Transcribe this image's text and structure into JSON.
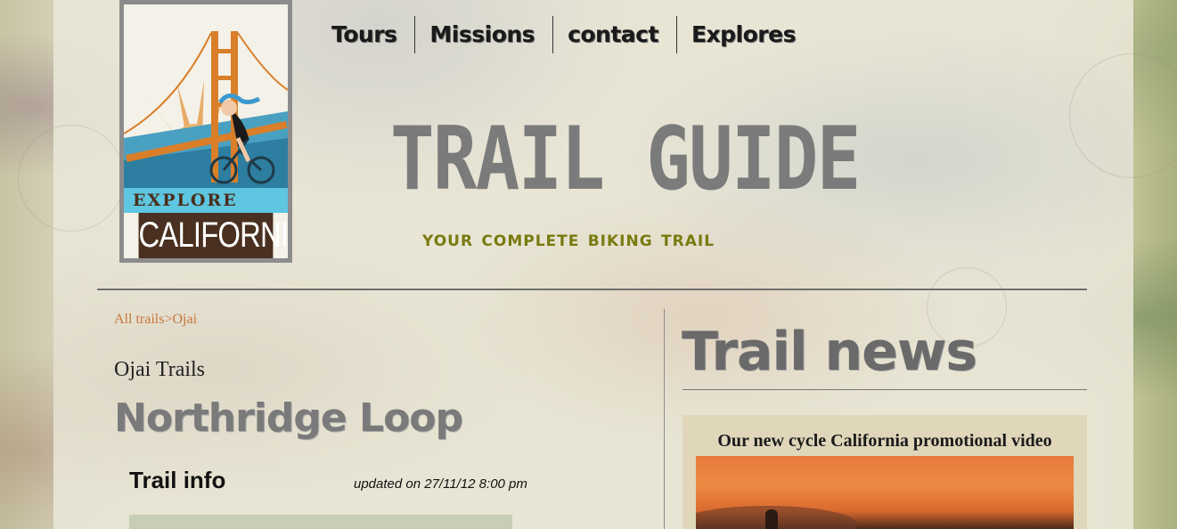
{
  "logo": {
    "explore": "EXPLORE",
    "california": "CALIFORNIA"
  },
  "nav": {
    "items": [
      {
        "label": "Tours"
      },
      {
        "label": "Missions"
      },
      {
        "label": "contact"
      },
      {
        "label": "Explores"
      }
    ]
  },
  "header": {
    "title": "TRAIL GUIDE",
    "tagline": "your complete biking trail"
  },
  "breadcrumb": {
    "parent": "All trails",
    "separator": ">",
    "current": "Ojai"
  },
  "trail": {
    "section": "Ojai Trails",
    "name": "Northridge Loop",
    "info_title": "Trail info",
    "updated": "updated on 27/11/12 8:00 pm"
  },
  "news": {
    "title": "Trail news",
    "card_title": "Our new cycle California promotional video"
  },
  "colors": {
    "accent_orange": "#c7773a",
    "tagline_olive": "#7a7a10",
    "title_gray": "#7b7b7b",
    "logo_blue": "#5ec6e0",
    "logo_brown": "#4a3020"
  }
}
